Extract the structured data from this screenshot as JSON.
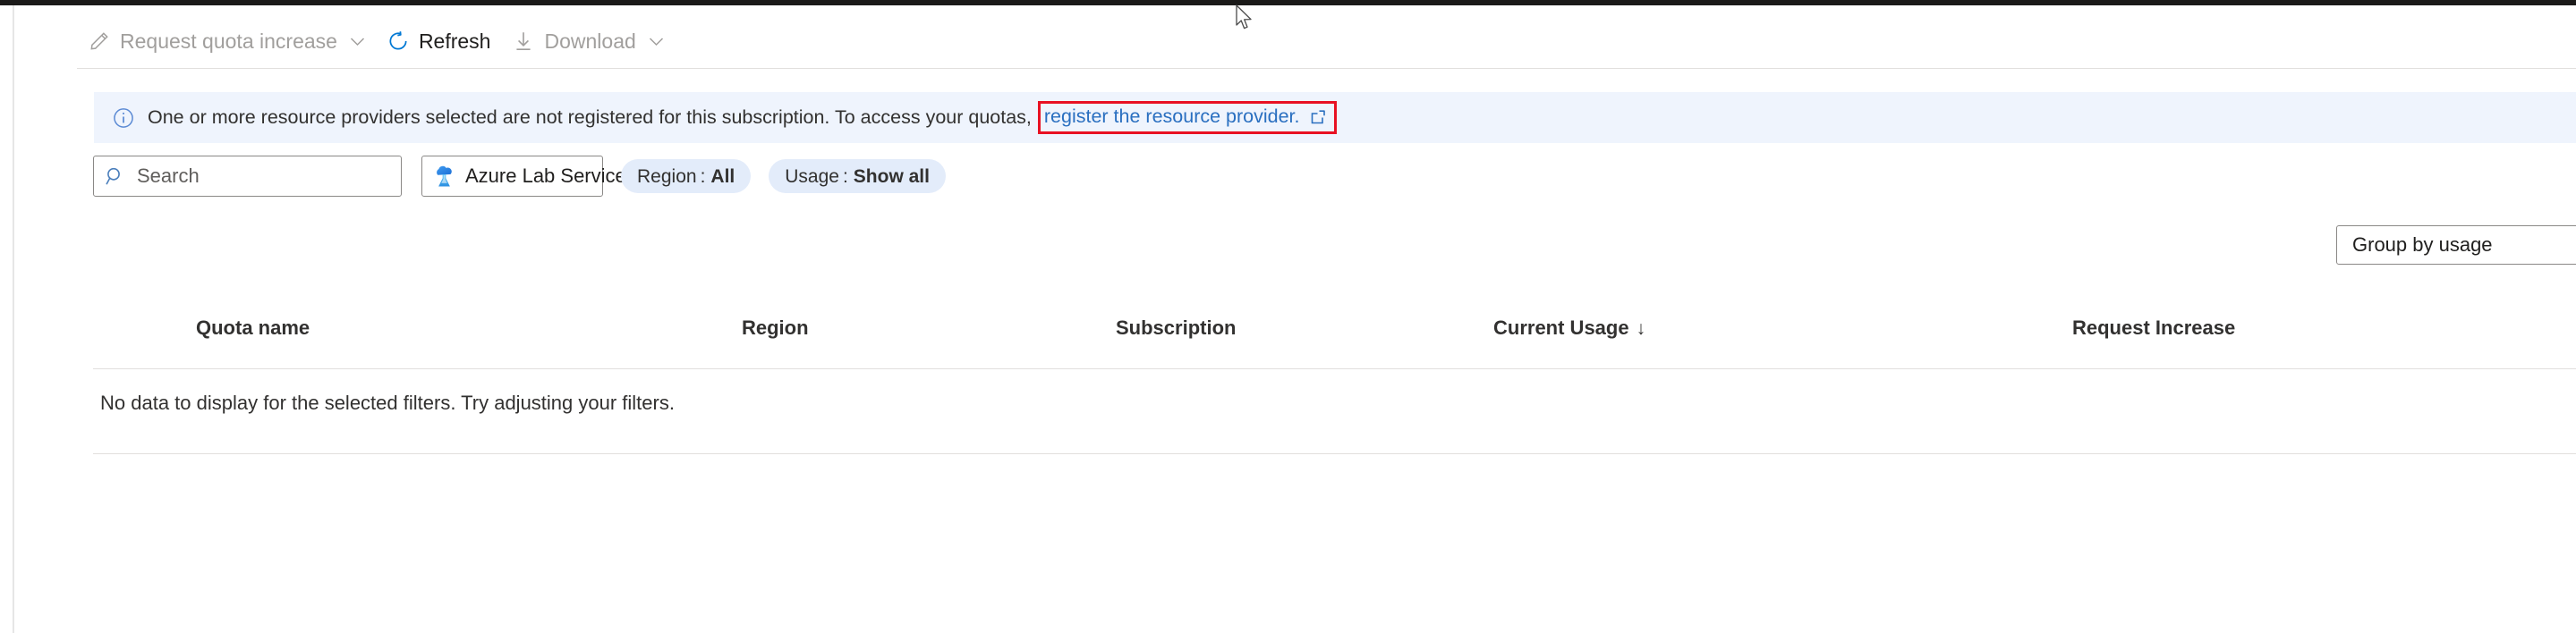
{
  "window": {
    "collapse_chevron": "»"
  },
  "toolbar": {
    "items": [
      {
        "label": "Request quota increase",
        "icon": "pencil-icon",
        "caret": "⌄",
        "enabled": false
      },
      {
        "label": "Refresh",
        "icon": "refresh-icon",
        "caret": "",
        "enabled": true
      },
      {
        "label": "Download",
        "icon": "download-icon",
        "caret": "⌄",
        "enabled": false
      }
    ]
  },
  "notification": {
    "icon": "info-icon",
    "message": "One or more resource providers selected are not registered for this subscription. To access your quotas,",
    "link_text": "register the resource provider.",
    "link_icon": "external-link-icon",
    "highlight_color": "#e81123",
    "background": "#eff4fd"
  },
  "filters": {
    "search": {
      "placeholder": "Search",
      "value": "",
      "icon": "search-icon"
    },
    "provider": {
      "label": "Azure Lab Services",
      "icon": "azure-lab-services-icon",
      "caret": "⌄"
    },
    "pills": [
      {
        "key": "Region",
        "separator": ":",
        "value": "All"
      },
      {
        "key": "Usage",
        "separator": ":",
        "value": "Show all"
      }
    ]
  },
  "group_by": {
    "label": "Group by usage"
  },
  "table": {
    "columns": [
      {
        "label": "Quota name",
        "sort": ""
      },
      {
        "label": "Region",
        "sort": ""
      },
      {
        "label": "Subscription",
        "sort": ""
      },
      {
        "label": "Current Usage",
        "sort": "↓"
      },
      {
        "label": "Request Increase",
        "sort": ""
      }
    ],
    "empty_message": "No data to display for the selected filters. Try adjusting your filters."
  }
}
